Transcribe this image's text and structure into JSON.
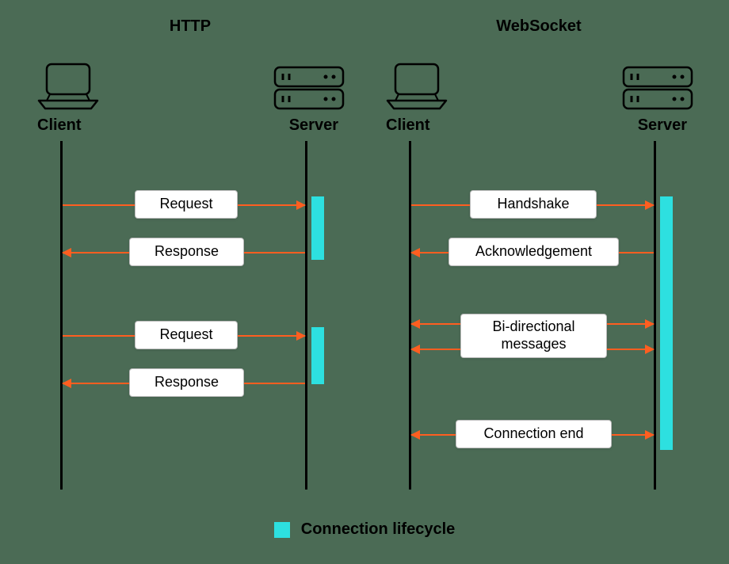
{
  "left": {
    "title": "HTTP",
    "client_label": "Client",
    "server_label": "Server",
    "messages": {
      "request1": "Request",
      "response1": "Response",
      "request2": "Request",
      "response2": "Response"
    }
  },
  "right": {
    "title": "WebSocket",
    "client_label": "Client",
    "server_label": "Server",
    "messages": {
      "handshake": "Handshake",
      "acknowledgement": "Acknowledgement",
      "bidirectional": "Bi-directional messages",
      "connection_end": "Connection end"
    }
  },
  "legend": {
    "label": "Connection lifecycle"
  },
  "colors": {
    "background": "#4b6b55",
    "arrow": "#ff5e20",
    "lifecycle": "#2de0e0"
  }
}
